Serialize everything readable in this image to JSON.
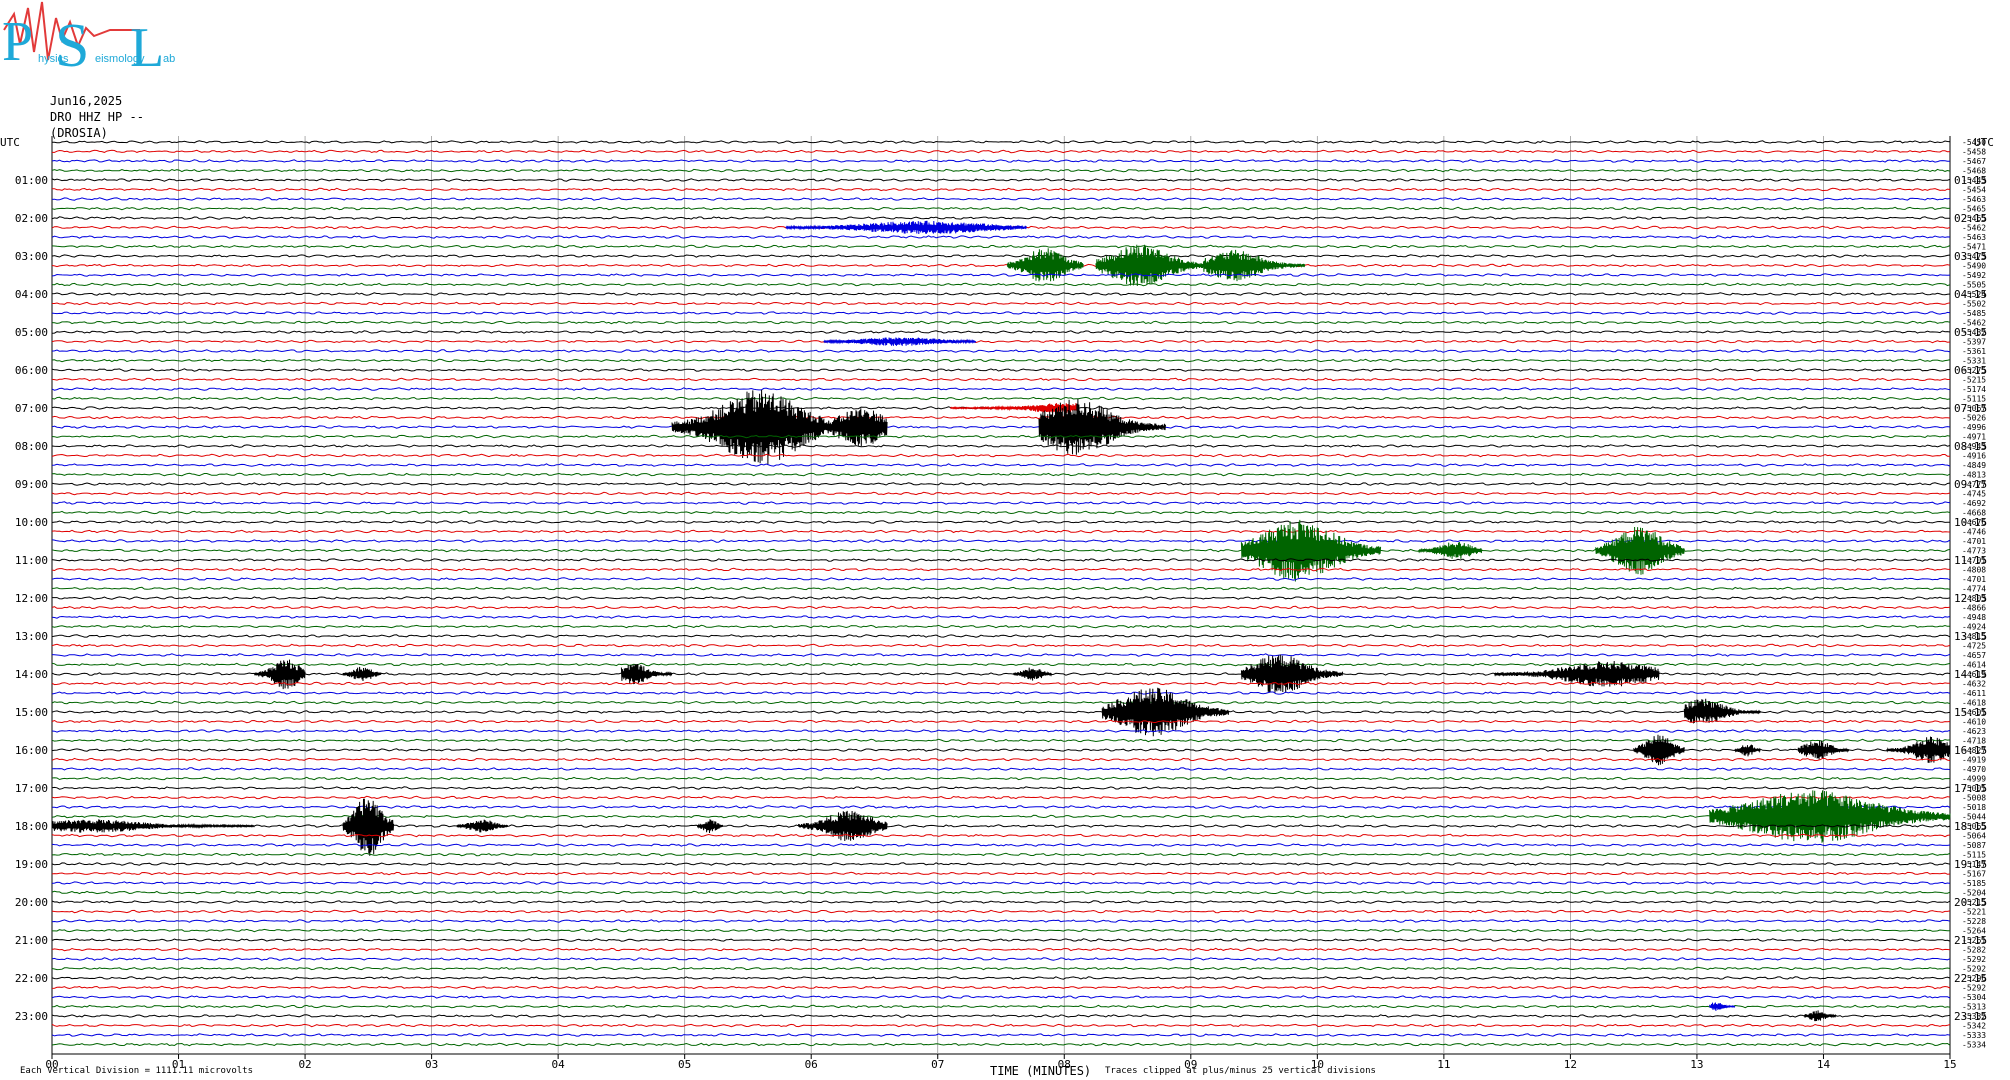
{
  "logo": {
    "letters": "PSL",
    "text": "Physics Seismology Lab",
    "colors": [
      "#1fa9d8",
      "#e23a3a"
    ]
  },
  "header": {
    "date": "Jun16,2025",
    "station": "DRO HHZ HP --",
    "site": "(DROSIA)"
  },
  "footer": {
    "vertical_division": "Each Vertical Division = 1111.11 microvolts",
    "xaxis_title": "TIME (MINUTES)",
    "clip_note": "Traces clipped at plus/minus 25 vertical divisions"
  },
  "chart_data": {
    "type": "line",
    "title": "",
    "xlabel": "TIME (MINUTES)",
    "ylabel": "UTC",
    "right_ylabel": "UTC",
    "xlim": [
      0,
      15
    ],
    "x_ticks": [
      "00",
      "01",
      "02",
      "03",
      "04",
      "05",
      "06",
      "07",
      "08",
      "09",
      "10",
      "11",
      "12",
      "13",
      "14",
      "15"
    ],
    "left_time_labels": [
      "01:00",
      "02:00",
      "03:00",
      "04:00",
      "05:00",
      "06:00",
      "07:00",
      "08:00",
      "09:00",
      "10:00",
      "11:00",
      "12:00",
      "13:00",
      "14:00",
      "15:00",
      "16:00",
      "17:00",
      "18:00",
      "19:00",
      "20:00",
      "21:00",
      "22:00",
      "23:00"
    ],
    "right_time_labels": [
      "01:15",
      "02:15",
      "03:15",
      "04:15",
      "05:15",
      "06:15",
      "07:15",
      "08:15",
      "09:15",
      "10:15",
      "11:15",
      "12:15",
      "13:15",
      "14:15",
      "15:15",
      "16:15",
      "17:15",
      "18:15",
      "19:15",
      "20:15",
      "21:15",
      "22:15",
      "23:15"
    ],
    "trace_colors": [
      "#000000",
      "#e00000",
      "#0000e0",
      "#006400"
    ],
    "trace_minutes": 15,
    "trace_count": 96,
    "offsets": [
      -5450,
      -5458,
      -5467,
      -5468,
      -5443,
      -5454,
      -5463,
      -5465,
      -5465,
      -5462,
      -5463,
      -5471,
      -5473,
      -5490,
      -5492,
      -5505,
      -5524,
      -5502,
      -5485,
      -5462,
      -5432,
      -5397,
      -5361,
      -5331,
      -5275,
      -5215,
      -5174,
      -5115,
      -5067,
      -5026,
      -4996,
      -4971,
      -4943,
      -4916,
      -4849,
      -4813,
      -4777,
      -4745,
      -4692,
      -4668,
      -4676,
      -4746,
      -4701,
      -4773,
      -4701,
      -4808,
      -4701,
      -4774,
      -4803,
      -4866,
      -4948,
      -4924,
      -4815,
      -4725,
      -4657,
      -4614,
      -4619,
      -4632,
      -4611,
      -4618,
      -4601,
      -4610,
      -4623,
      -4718,
      -4827,
      -4919,
      -4970,
      -4999,
      -5001,
      -5008,
      -5018,
      -5044,
      -5065,
      -5064,
      -5087,
      -5115,
      -5147,
      -5167,
      -5185,
      -5204,
      -5215,
      -5221,
      -5228,
      -5264,
      -5261,
      -5282,
      -5292,
      -5292,
      -5296,
      -5292,
      -5304,
      -5313,
      -5332,
      -5342,
      -5333,
      -5334
    ],
    "events": [
      {
        "trace": 9,
        "t0": 5.8,
        "t1": 7.7,
        "amp": 6,
        "peak": 6.9,
        "color": "#0000e0"
      },
      {
        "trace": 13,
        "t0": 7.55,
        "t1": 8.15,
        "amp": 16,
        "peak": 7.85,
        "color": "#006400"
      },
      {
        "trace": 13,
        "t0": 8.25,
        "t1": 9.1,
        "amp": 20,
        "peak": 8.6,
        "color": "#006400"
      },
      {
        "trace": 13,
        "t0": 9.1,
        "t1": 9.9,
        "amp": 14,
        "peak": 9.35,
        "color": "#006400"
      },
      {
        "trace": 21,
        "t0": 6.1,
        "t1": 7.3,
        "amp": 4,
        "peak": 6.7,
        "color": "#0000e0"
      },
      {
        "trace": 28,
        "t0": 7.1,
        "t1": 8.1,
        "amp": 5,
        "peak": 8.0,
        "color": "#e00000"
      },
      {
        "trace": 30,
        "t0": 4.9,
        "t1": 6.1,
        "amp": 34,
        "peak": 5.6,
        "color": "#000000"
      },
      {
        "trace": 30,
        "t0": 5.9,
        "t1": 6.6,
        "amp": 18,
        "peak": 6.4,
        "color": "#000000"
      },
      {
        "trace": 30,
        "t0": 7.8,
        "t1": 8.8,
        "amp": 26,
        "peak": 8.1,
        "color": "#000000"
      },
      {
        "trace": 43,
        "t0": 9.4,
        "t1": 10.5,
        "amp": 28,
        "peak": 9.85,
        "color": "#006400"
      },
      {
        "trace": 43,
        "t0": 10.8,
        "t1": 11.3,
        "amp": 8,
        "peak": 11.1,
        "color": "#006400"
      },
      {
        "trace": 43,
        "t0": 12.2,
        "t1": 12.9,
        "amp": 22,
        "peak": 12.55,
        "color": "#006400"
      },
      {
        "trace": 56,
        "t0": 1.6,
        "t1": 2.0,
        "amp": 14,
        "peak": 1.85,
        "color": "#000000"
      },
      {
        "trace": 56,
        "t0": 2.3,
        "t1": 2.6,
        "amp": 7,
        "peak": 2.45,
        "color": "#000000"
      },
      {
        "trace": 56,
        "t0": 4.5,
        "t1": 4.9,
        "amp": 10,
        "peak": 4.6,
        "color": "#000000"
      },
      {
        "trace": 56,
        "t0": 7.6,
        "t1": 7.9,
        "amp": 6,
        "peak": 7.75,
        "color": "#000000"
      },
      {
        "trace": 56,
        "t0": 9.4,
        "t1": 10.2,
        "amp": 18,
        "peak": 9.7,
        "color": "#000000"
      },
      {
        "trace": 56,
        "t0": 11.4,
        "t1": 12.7,
        "amp": 12,
        "peak": 12.3,
        "color": "#000000"
      },
      {
        "trace": 60,
        "t0": 8.3,
        "t1": 9.3,
        "amp": 22,
        "peak": 8.7,
        "color": "#000000"
      },
      {
        "trace": 60,
        "t0": 12.9,
        "t1": 13.5,
        "amp": 12,
        "peak": 13.05,
        "color": "#000000"
      },
      {
        "trace": 64,
        "t0": 12.5,
        "t1": 12.9,
        "amp": 14,
        "peak": 12.7,
        "color": "#000000"
      },
      {
        "trace": 64,
        "t0": 13.3,
        "t1": 13.5,
        "amp": 6,
        "peak": 13.4,
        "color": "#000000"
      },
      {
        "trace": 64,
        "t0": 13.8,
        "t1": 14.2,
        "amp": 9,
        "peak": 13.95,
        "color": "#000000"
      },
      {
        "trace": 64,
        "t0": 14.5,
        "t1": 15.0,
        "amp": 12,
        "peak": 14.85,
        "color": "#000000"
      },
      {
        "trace": 71,
        "t0": 13.1,
        "t1": 15.0,
        "amp": 24,
        "peak": 13.9,
        "color": "#006400"
      },
      {
        "trace": 72,
        "t0": 0.0,
        "t1": 1.6,
        "amp": 6,
        "peak": 0.3,
        "color": "#000000"
      },
      {
        "trace": 72,
        "t0": 2.3,
        "t1": 2.7,
        "amp": 28,
        "peak": 2.5,
        "color": "#000000"
      },
      {
        "trace": 72,
        "t0": 3.2,
        "t1": 3.6,
        "amp": 6,
        "peak": 3.4,
        "color": "#000000"
      },
      {
        "trace": 72,
        "t0": 5.1,
        "t1": 5.3,
        "amp": 7,
        "peak": 5.2,
        "color": "#000000"
      },
      {
        "trace": 72,
        "t0": 5.9,
        "t1": 6.6,
        "amp": 14,
        "peak": 6.3,
        "color": "#000000"
      },
      {
        "trace": 91,
        "t0": 13.1,
        "t1": 13.3,
        "amp": 4,
        "peak": 13.15,
        "color": "#0000e0"
      },
      {
        "trace": 92,
        "t0": 13.85,
        "t1": 14.1,
        "amp": 5,
        "peak": 13.95,
        "color": "#000000"
      }
    ]
  }
}
